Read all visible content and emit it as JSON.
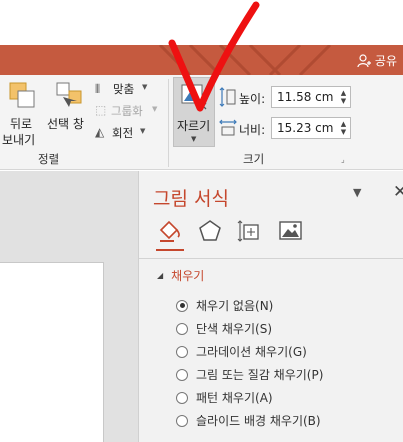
{
  "titlebar": {
    "share_label": "공유"
  },
  "ribbon": {
    "send_backward_line1": "뒤로",
    "send_backward_line2": "보내기",
    "selection_pane_label": "선택 창",
    "align_label": "맞춤",
    "group_label": "그룹화",
    "rotate_label": "회전",
    "arrange_group_label": "정렬",
    "crop_label": "자르기",
    "height_label": "높이:",
    "height_value": "11.58 cm",
    "width_label": "너비:",
    "width_value": "15.23 cm",
    "size_group_label": "크기"
  },
  "pane": {
    "title": "그림 서식",
    "section_title": "채우기",
    "fill_options": [
      {
        "label": "채우기 없음(N)",
        "checked": true
      },
      {
        "label": "단색 채우기(S)",
        "checked": false
      },
      {
        "label": "그라데이션 채우기(G)",
        "checked": false
      },
      {
        "label": "그림 또는 질감 채우기(P)",
        "checked": false
      },
      {
        "label": "패턴 채우기(A)",
        "checked": false
      },
      {
        "label": "슬라이드 배경 채우기(B)",
        "checked": false
      }
    ]
  },
  "colors": {
    "accent": "#c5472d",
    "titlebar": "#c55a3f",
    "annotation": "#ee1111"
  }
}
